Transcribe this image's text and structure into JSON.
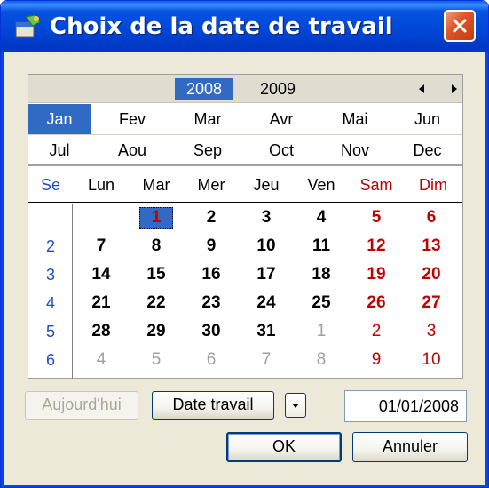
{
  "window": {
    "title": "Choix de la date de travail",
    "colors": {
      "titlebar": "#0045d6",
      "selection": "#316ac5",
      "weekend": "#c00000",
      "weeknum": "#1f4fbf"
    }
  },
  "calendar": {
    "years": [
      {
        "label": "2008",
        "selected": true
      },
      {
        "label": "2009",
        "selected": false
      }
    ],
    "months": [
      {
        "label": "Jan",
        "selected": true
      },
      {
        "label": "Fev",
        "selected": false
      },
      {
        "label": "Mar",
        "selected": false
      },
      {
        "label": "Avr",
        "selected": false
      },
      {
        "label": "Mai",
        "selected": false
      },
      {
        "label": "Jun",
        "selected": false
      },
      {
        "label": "Jul",
        "selected": false
      },
      {
        "label": "Aou",
        "selected": false
      },
      {
        "label": "Sep",
        "selected": false
      },
      {
        "label": "Oct",
        "selected": false
      },
      {
        "label": "Nov",
        "selected": false
      },
      {
        "label": "Dec",
        "selected": false
      }
    ],
    "weekday_headers": [
      "Se",
      "Lun",
      "Mar",
      "Mer",
      "Jeu",
      "Ven",
      "Sam",
      "Dim"
    ],
    "week_numbers": [
      "",
      "2",
      "3",
      "4",
      "5",
      "6"
    ],
    "days": [
      [
        null,
        {
          "d": "1",
          "cur": true,
          "sel": true
        },
        {
          "d": "2",
          "cur": true
        },
        {
          "d": "3",
          "cur": true
        },
        {
          "d": "4",
          "cur": true
        },
        {
          "d": "5",
          "cur": true
        },
        {
          "d": "6",
          "cur": true
        }
      ],
      [
        {
          "d": "7",
          "cur": true
        },
        {
          "d": "8",
          "cur": true
        },
        {
          "d": "9",
          "cur": true
        },
        {
          "d": "10",
          "cur": true
        },
        {
          "d": "11",
          "cur": true
        },
        {
          "d": "12",
          "cur": true
        },
        {
          "d": "13",
          "cur": true
        }
      ],
      [
        {
          "d": "14",
          "cur": true
        },
        {
          "d": "15",
          "cur": true
        },
        {
          "d": "16",
          "cur": true
        },
        {
          "d": "17",
          "cur": true
        },
        {
          "d": "18",
          "cur": true
        },
        {
          "d": "19",
          "cur": true
        },
        {
          "d": "20",
          "cur": true
        }
      ],
      [
        {
          "d": "21",
          "cur": true
        },
        {
          "d": "22",
          "cur": true
        },
        {
          "d": "23",
          "cur": true
        },
        {
          "d": "24",
          "cur": true
        },
        {
          "d": "25",
          "cur": true
        },
        {
          "d": "26",
          "cur": true
        },
        {
          "d": "27",
          "cur": true
        }
      ],
      [
        {
          "d": "28",
          "cur": true
        },
        {
          "d": "29",
          "cur": true
        },
        {
          "d": "30",
          "cur": true
        },
        {
          "d": "31",
          "cur": true
        },
        {
          "d": "1",
          "cur": false
        },
        {
          "d": "2",
          "cur": false
        },
        {
          "d": "3",
          "cur": false
        }
      ],
      [
        {
          "d": "4",
          "cur": false
        },
        {
          "d": "5",
          "cur": false
        },
        {
          "d": "6",
          "cur": false
        },
        {
          "d": "7",
          "cur": false
        },
        {
          "d": "8",
          "cur": false
        },
        {
          "d": "9",
          "cur": false
        },
        {
          "d": "10",
          "cur": false
        }
      ]
    ]
  },
  "controls": {
    "today_label": "Aujourd'hui",
    "work_date_label": "Date travail",
    "date_value": "01/01/2008",
    "ok_label": "OK",
    "cancel_label": "Annuler"
  }
}
